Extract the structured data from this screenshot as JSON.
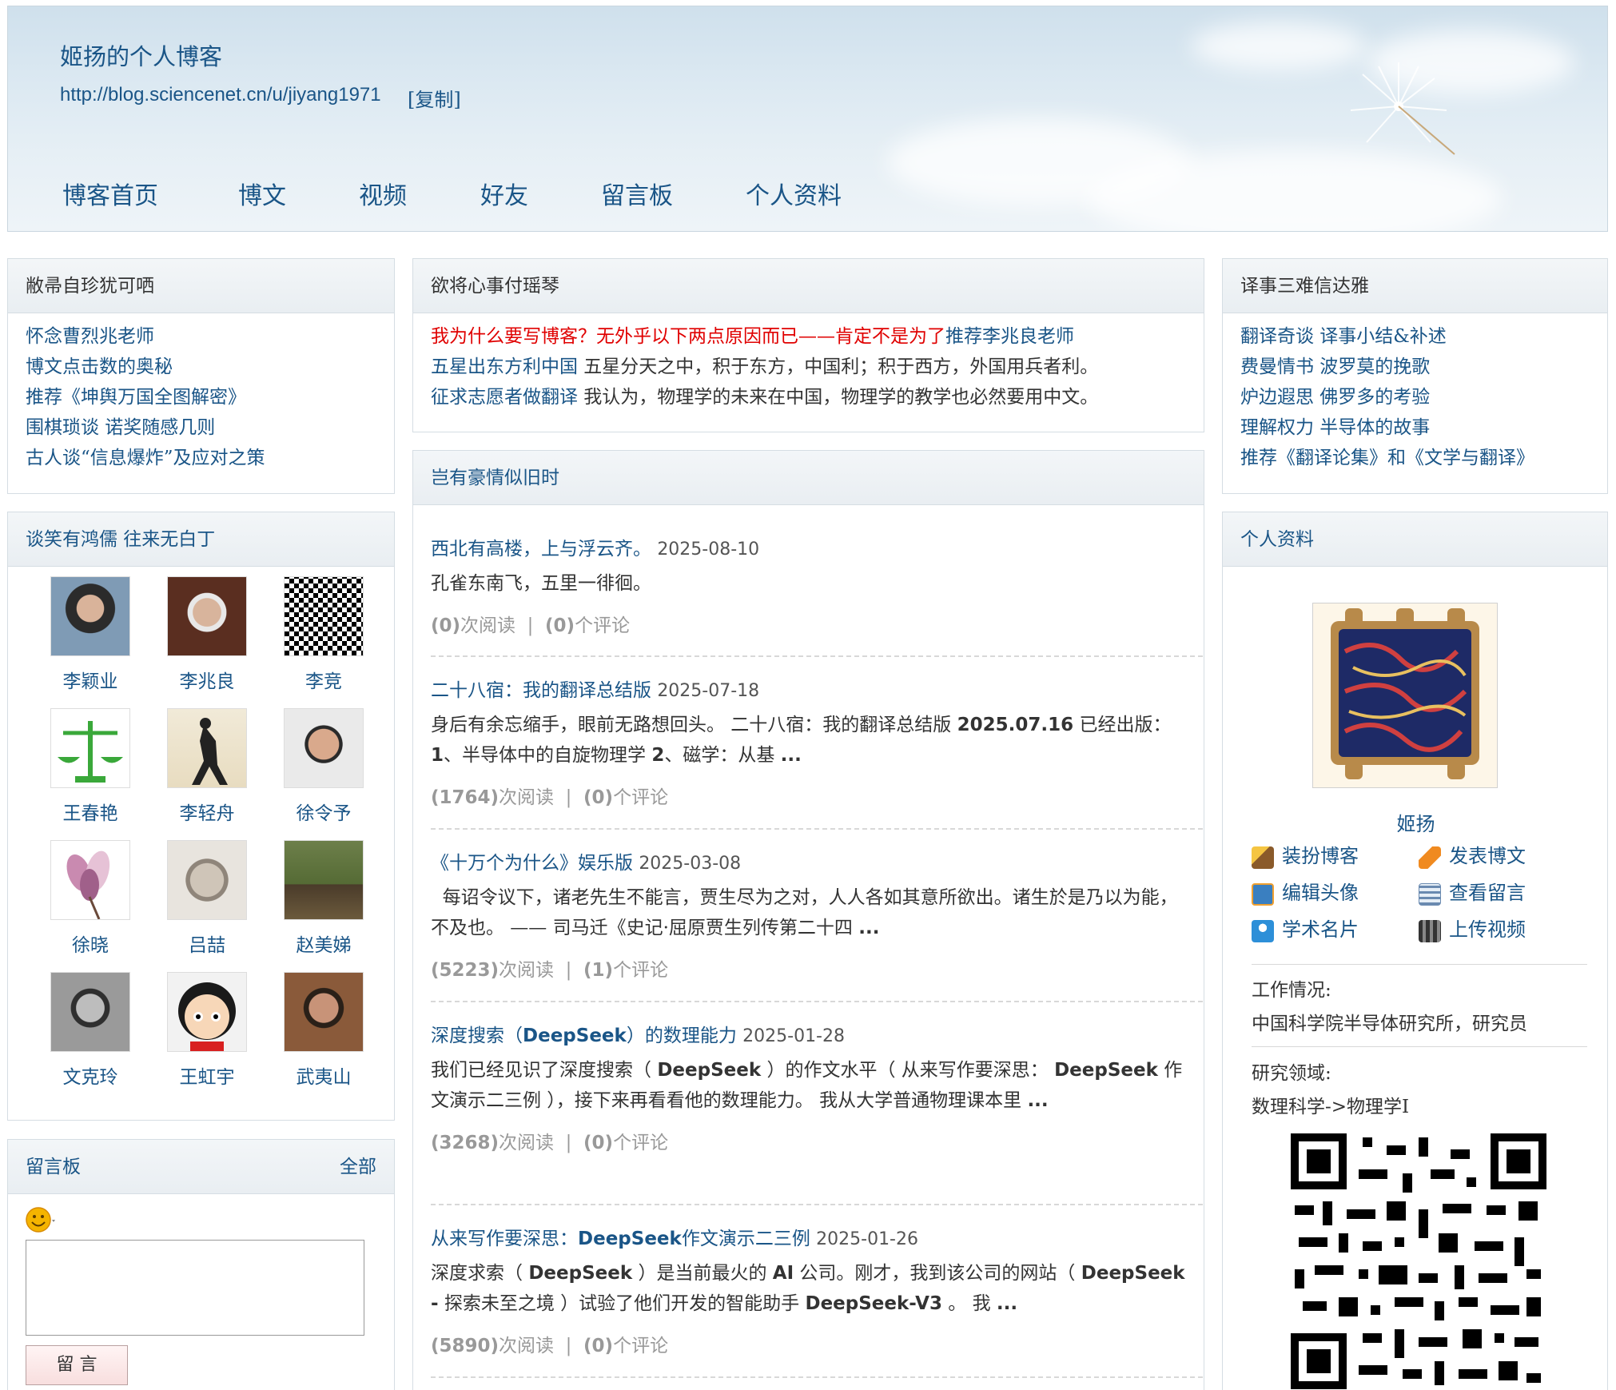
{
  "header": {
    "title": "姬扬的个人博客",
    "url": "http://blog.sciencenet.cn/u/jiyang1971",
    "copy_label": "[复制]",
    "nav": [
      "博客首页",
      "博文",
      "视频",
      "好友",
      "留言板",
      "个人资料"
    ]
  },
  "left": {
    "panel1": {
      "title": "敝帚自珍犹可哂",
      "links": [
        "怀念曹烈兆老师",
        "博文点击数的奥秘",
        "推荐《坤舆万国全图解密》",
        "围棋琐谈 诺奖随感几则",
        "古人谈“信息爆炸”及应对之策"
      ]
    },
    "panel2": {
      "title": "谈笑有鸿儒 往来无白丁",
      "friends": [
        "李颖业",
        "李兆良",
        "李竞",
        "王春艳",
        "李轻舟",
        "徐令予",
        "徐晓",
        "吕喆",
        "赵美娣",
        "文克玲",
        "王虹宇",
        "武夷山"
      ]
    },
    "panel3": {
      "title": "留言板",
      "all_link": "全部",
      "submit_label": "留 言"
    }
  },
  "center": {
    "panel1": {
      "title": "欲将心事付瑶琴",
      "line1_red": "我为什么要写博客？无外乎以下两点原因而已——肯定不是为了",
      "line1_link": "推荐李兆良老师",
      "line2_link": "五星出东方利中国",
      "line2_text": " 五星分天之中，积于东方，中国利；积于西方，外国用兵者利。",
      "line3_link": "征求志愿者做翻译",
      "line3_text": " 我认为，物理学的未来在中国，物理学的教学也必然要用中文。"
    },
    "panel2": {
      "title": "岂有豪情似旧时",
      "posts": [
        {
          "title": "西北有高楼，上与浮云齐。",
          "date": "2025-08-10",
          "body": "孔雀东南飞，五里一徘徊。",
          "reads": "(0)",
          "reads_label": "次阅读",
          "comments": "(0)",
          "comments_label": "个评论"
        },
        {
          "title": "二十八宿：我的翻译总结版",
          "date": "2025-07-18",
          "body1": "身后有余忘缩手，眼前无路想回头。 二十八宿：我的翻译总结版 ",
          "body_bold1": "2025.07.16",
          "body2": " 已经出版： ",
          "body_bold2": "1",
          "body3": "、半导体中的自旋物理学 ",
          "body_bold3": "2",
          "body4": "、磁学：从基 ",
          "body_end": "...",
          "reads": "(1764)",
          "reads_label": "次阅读",
          "comments": "(0)",
          "comments_label": "个评论"
        },
        {
          "title": "《十万个为什么》娱乐版",
          "date": "2025-03-08",
          "body": "  每诏令议下，诸老先生不能言，贾生尽为之对，人人各如其意所欲出。诸生於是乃以为能，不及也。 —— 司马迁《史记·屈原贾生列传第二十四 ",
          "body_end": "...",
          "reads": "(5223)",
          "reads_label": "次阅读",
          "comments": "(1)",
          "comments_label": "个评论"
        },
        {
          "title_pre": "深度搜索（",
          "title_bold": "DeepSeek",
          "title_post": "）的数理能力",
          "date": "2025-01-28",
          "body1": "我们已经见识了深度搜索（ ",
          "body_bold1": "DeepSeek",
          "body2": " ）的作文水平（ 从来写作要深思： ",
          "body_bold2": "DeepSeek",
          "body3": " 作文演示二三例 ），接下来再看看他的数理能力。 我从大学普通物理课本里 ",
          "body_end": "...",
          "reads": "(3268)",
          "reads_label": "次阅读",
          "comments": "(0)",
          "comments_label": "个评论"
        },
        {
          "title_pre": "从来写作要深思：",
          "title_bold": "DeepSeek",
          "title_post": "作文演示二三例",
          "date": "2025-01-26",
          "body1": "深度求索（ ",
          "body_bold1": "DeepSeek",
          "body2": " ）是当前最火的 ",
          "body_bold2": "AI",
          "body3": " 公司。刚才，我到该公司的网站（ ",
          "body_bold3": "DeepSeek -",
          "body4": " 探索未至之境 ）试验了他们开发的智能助手 ",
          "body_bold4": "DeepSeek-V3",
          "body5": " 。 我 ",
          "body_end": "...",
          "reads": "(5890)",
          "reads_label": "次阅读",
          "comments": "(0)",
          "comments_label": "个评论"
        }
      ]
    }
  },
  "right": {
    "panel1": {
      "title": "译事三难信达雅",
      "links": [
        "翻译奇谈 译事小结&补述",
        "费曼情书 波罗莫的挽歌",
        "炉边遐思 佛罗多的考验",
        "理解权力 半导体的故事",
        "推荐《翻译论集》和《文学与翻译》"
      ]
    },
    "panel2": {
      "title": "个人资料",
      "name": "姬扬",
      "actions": [
        "装扮博客",
        "发表博文",
        "编辑头像",
        "查看留言",
        "学术名片",
        "上传视频"
      ],
      "work_label": "工作情况:",
      "work_value": "中国科学院半导体研究所，研究员",
      "field_label": "研究领域:",
      "field_value": "数理科学->物理学I"
    }
  },
  "colors": {
    "link": "#1a5587",
    "red": "#e00000",
    "panel_border": "#d5dde3"
  }
}
